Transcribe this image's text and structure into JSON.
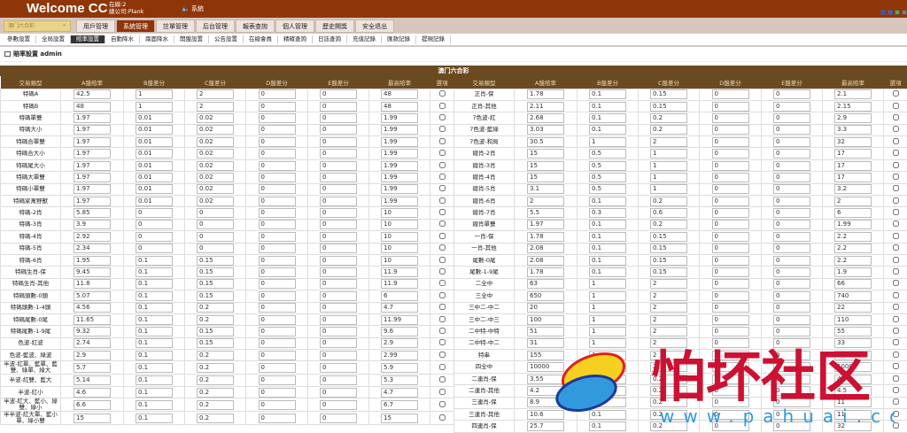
{
  "header": {
    "welcome": "Welcome CC",
    "online": "在線:2",
    "company": "總公司:Plank",
    "system": "系統",
    "skin_colors": [
      "#3355cc",
      "#7744cc",
      "#66aa33",
      "#cc6622"
    ]
  },
  "nav": {
    "select_value": "澳门六合彩",
    "items": [
      "用戶管理",
      "系統管理",
      "註單管理",
      "后台管理",
      "報表查詢",
      "個人管理",
      "歷史開獎",
      "安全退出"
    ],
    "active": 1
  },
  "subnav": {
    "items": [
      "參數設置",
      "全局設置",
      "賠率設置",
      "自動降水",
      "兩面降水",
      "開盤設置",
      "公告設置",
      "在線會員",
      "精確查詢",
      "日誌查詢",
      "充值記錄",
      "匯款記錄",
      "提現記錄"
    ],
    "active": 2
  },
  "page_title": "賠率設置 admin",
  "table": {
    "caption": "澳门六合彩",
    "columns": [
      "交易類型",
      "A盤賠率",
      "B盤差分",
      "C盤差分",
      "D盤差分",
      "E盤差分",
      "最高賠率",
      "選項"
    ],
    "left_rows": [
      [
        "特碼A",
        "42.5",
        "1",
        "2",
        "0",
        "0",
        "48"
      ],
      [
        "特碼B",
        "48",
        "1",
        "2",
        "0",
        "0",
        "48"
      ],
      [
        "特碼單雙",
        "1.97",
        "0.01",
        "0.02",
        "0",
        "0",
        "1.99"
      ],
      [
        "特碼大小",
        "1.97",
        "0.01",
        "0.02",
        "0",
        "0",
        "1.99"
      ],
      [
        "特碼合單雙",
        "1.97",
        "0.01",
        "0.02",
        "0",
        "0",
        "1.99"
      ],
      [
        "特碼合大小",
        "1.97",
        "0.01",
        "0.02",
        "0",
        "0",
        "1.99"
      ],
      [
        "特碼尾大小",
        "1.97",
        "0.01",
        "0.02",
        "0",
        "0",
        "1.99"
      ],
      [
        "特碼大單雙",
        "1.97",
        "0.01",
        "0.02",
        "0",
        "0",
        "1.99"
      ],
      [
        "特碼小單雙",
        "1.97",
        "0.01",
        "0.02",
        "0",
        "0",
        "1.99"
      ],
      [
        "特碼家禽野獸",
        "1.97",
        "0.01",
        "0.02",
        "0",
        "0",
        "1.99"
      ],
      [
        "特碼-2肖",
        "5.85",
        "0",
        "0",
        "0",
        "0",
        "10"
      ],
      [
        "特碼-3肖",
        "3.9",
        "0",
        "0",
        "0",
        "0",
        "10"
      ],
      [
        "特碼-4肖",
        "2.92",
        "0",
        "0",
        "0",
        "0",
        "10"
      ],
      [
        "特碼-5肖",
        "2.34",
        "0",
        "0",
        "0",
        "0",
        "10"
      ],
      [
        "特碼-6肖",
        "1.95",
        "0.1",
        "0.15",
        "0",
        "0",
        "10"
      ],
      [
        "特碼生肖-保",
        "9.45",
        "0.1",
        "0.15",
        "0",
        "0",
        "11.9"
      ],
      [
        "特碼生肖-其他",
        "11.8",
        "0.1",
        "0.15",
        "0",
        "0",
        "11.9"
      ],
      [
        "特碼頭數-0頭",
        "5.07",
        "0.1",
        "0.15",
        "0",
        "0",
        "6"
      ],
      [
        "特碼頭數-1-4頭",
        "4.56",
        "0.1",
        "0.2",
        "0",
        "0",
        "4.7"
      ],
      [
        "特碼尾數-0尾",
        "11.65",
        "0.1",
        "0.2",
        "0",
        "0",
        "11.99"
      ],
      [
        "特碼尾數-1-9尾",
        "9.32",
        "0.1",
        "0.15",
        "0",
        "0",
        "9.6"
      ],
      [
        "色波-紅波",
        "2.74",
        "0.1",
        "0.15",
        "0",
        "0",
        "2.9"
      ],
      [
        "色波-藍波、綠波",
        "2.9",
        "0.1",
        "0.2",
        "0",
        "0",
        "2.99"
      ],
      [
        "半波-紅單、藍單、藍雙、綠單、綠大",
        "5.7",
        "0.1",
        "0.2",
        "0",
        "0",
        "5.9"
      ],
      [
        "半波-紅雙、藍大",
        "5.14",
        "0.1",
        "0.2",
        "0",
        "0",
        "5.3"
      ],
      [
        "半波-紅小",
        "4.6",
        "0.1",
        "0.2",
        "0",
        "0",
        "4.7"
      ],
      [
        "半波-紅大、藍小、綠雙、綠小",
        "6.6",
        "0.1",
        "0.2",
        "0",
        "0",
        "6.7"
      ],
      [
        "半半波-紅大單、藍小單、綠小雙",
        "15",
        "0.1",
        "0.2",
        "0",
        "0",
        "15"
      ]
    ],
    "right_rows": [
      [
        "正肖-保",
        "1.78",
        "0.1",
        "0.15",
        "0",
        "0",
        "2.1"
      ],
      [
        "正肖-其他",
        "2.11",
        "0.1",
        "0.15",
        "0",
        "0",
        "2.15"
      ],
      [
        "7色波-紅",
        "2.68",
        "0.1",
        "0.2",
        "0",
        "0",
        "2.9"
      ],
      [
        "7色波-藍綠",
        "3.03",
        "0.1",
        "0.2",
        "0",
        "0",
        "3.3"
      ],
      [
        "7色波-和局",
        "30.5",
        "1",
        "2",
        "0",
        "0",
        "32"
      ],
      [
        "總肖-2肖",
        "15",
        "0.5",
        "1",
        "0",
        "0",
        "17"
      ],
      [
        "總肖-3肖",
        "15",
        "0.5",
        "1",
        "0",
        "0",
        "17"
      ],
      [
        "總肖-4肖",
        "15",
        "0.5",
        "1",
        "0",
        "0",
        "17"
      ],
      [
        "總肖-5肖",
        "3.1",
        "0.5",
        "1",
        "0",
        "0",
        "3.2"
      ],
      [
        "總肖-6肖",
        "2",
        "0.1",
        "0.2",
        "0",
        "0",
        "2"
      ],
      [
        "總肖-7肖",
        "5.5",
        "0.3",
        "0.6",
        "0",
        "0",
        "6"
      ],
      [
        "總肖單雙",
        "1.97",
        "0.1",
        "0.2",
        "0",
        "0",
        "1.99"
      ],
      [
        "一肖-保",
        "1.78",
        "0.1",
        "0.15",
        "0",
        "0",
        "2.2"
      ],
      [
        "一肖-其他",
        "2.08",
        "0.1",
        "0.15",
        "0",
        "0",
        "2.2"
      ],
      [
        "尾數-0尾",
        "2.08",
        "0.1",
        "0.15",
        "0",
        "0",
        "2.2"
      ],
      [
        "尾數-1-9尾",
        "1.78",
        "0.1",
        "0.15",
        "0",
        "0",
        "1.9"
      ],
      [
        "二全中",
        "63",
        "1",
        "2",
        "0",
        "0",
        "66"
      ],
      [
        "三全中",
        "650",
        "1",
        "2",
        "0",
        "0",
        "740"
      ],
      [
        "三中二-中二",
        "20",
        "1",
        "2",
        "0",
        "0",
        "22"
      ],
      [
        "三中二-中三",
        "100",
        "1",
        "2",
        "0",
        "0",
        "110"
      ],
      [
        "二中特-中特",
        "51",
        "1",
        "2",
        "0",
        "0",
        "55"
      ],
      [
        "二中特-中二",
        "31",
        "1",
        "2",
        "0",
        "0",
        "33"
      ],
      [
        "特串",
        "155",
        "1",
        "2",
        "0",
        "0",
        "160"
      ],
      [
        "四全中",
        "10000",
        "1",
        "2",
        "0",
        "0",
        "10000"
      ],
      [
        "二連肖-保",
        "3.55",
        "0.1",
        "0.2",
        "0",
        "0",
        "4"
      ],
      [
        "二連肖-其他",
        "4.2",
        "0.1",
        "0.2",
        "0",
        "0",
        "4.5"
      ],
      [
        "三連肖-保",
        "8.9",
        "0.1",
        "0.2",
        "0",
        "0",
        "11"
      ],
      [
        "三連肖-其他",
        "10.6",
        "0.1",
        "0.2",
        "0",
        "0",
        "11"
      ],
      [
        "四連肖-保",
        "25.7",
        "0.1",
        "0.2",
        "0",
        "0",
        "32"
      ]
    ]
  },
  "watermark": {
    "text": "怕坏社区",
    "url": "www.pahuai.com"
  }
}
